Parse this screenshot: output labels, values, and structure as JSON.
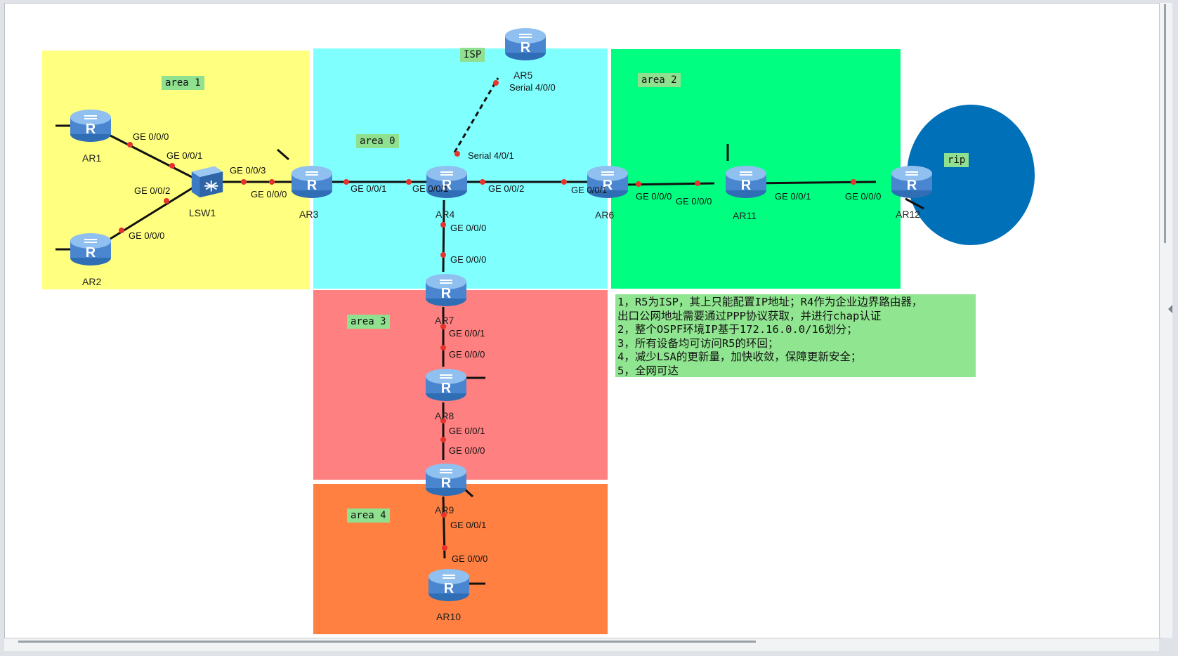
{
  "colors": {
    "area1": "#ffff80",
    "area0": "#80ffff",
    "area2": "#00ff80",
    "area3": "#ff8080",
    "area4": "#ff8040",
    "rip": "#0070b8",
    "tag_bg": "#8fe08f",
    "notes_bg": "#90e690",
    "link": "#111111",
    "port_dot": "#e8322a",
    "router_body": "#4a86d0"
  },
  "areas": {
    "area1": "area 1",
    "area0": "area 0",
    "area2": "area 2",
    "area3": "area 3",
    "area4": "area 4",
    "isp": "ISP",
    "rip": "rip"
  },
  "devices": {
    "ar1": "AR1",
    "ar2": "AR2",
    "lsw1": "LSW1",
    "ar3": "AR3",
    "ar4": "AR4",
    "ar5": "AR5",
    "ar6": "AR6",
    "ar7": "AR7",
    "ar8": "AR8",
    "ar9": "AR9",
    "ar10": "AR10",
    "ar11": "AR11",
    "ar12": "AR12"
  },
  "ports": {
    "ar1_g000": "GE 0/0/0",
    "lsw1_g001": "GE 0/0/1",
    "lsw1_g002": "GE 0/0/2",
    "ar2_g000": "GE 0/0/0",
    "lsw1_g003": "GE 0/0/3",
    "ar3_g000": "GE 0/0/0",
    "ar3_g001": "GE 0/0/1",
    "ar4_g001": "GE 0/0/1",
    "ar4_g002": "GE 0/0/2",
    "ar4_g000": "GE 0/0/0",
    "ar4_s401": "Serial 4/0/1",
    "ar5_s400": "Serial 4/0/0",
    "ar6_g001": "GE 0/0/1",
    "ar6_g000": "GE 0/0/0",
    "ar11_g000": "GE 0/0/0",
    "ar11_g001": "GE 0/0/1",
    "ar12_g000": "GE 0/0/0",
    "ar7_g000": "GE 0/0/0",
    "ar7_g001": "GE 0/0/1",
    "ar8_g000": "GE 0/0/0",
    "ar8_g001": "GE 0/0/1",
    "ar9_g000": "GE 0/0/0",
    "ar9_g001": "GE 0/0/1",
    "ar10_g000": "GE 0/0/0"
  },
  "requirements": [
    "1，R5为ISP，其上只能配置IP地址；R4作为企业边界路由器，",
    "出口公网地址需要通过PPP协议获取，并进行chap认证",
    "2，整个OSPF环境IP基于172.16.0.0/16划分；",
    "3，所有设备均可访问R5的环回；",
    "4，减少LSA的更新量，加快收敛，保障更新安全；",
    "5，全网可达"
  ]
}
